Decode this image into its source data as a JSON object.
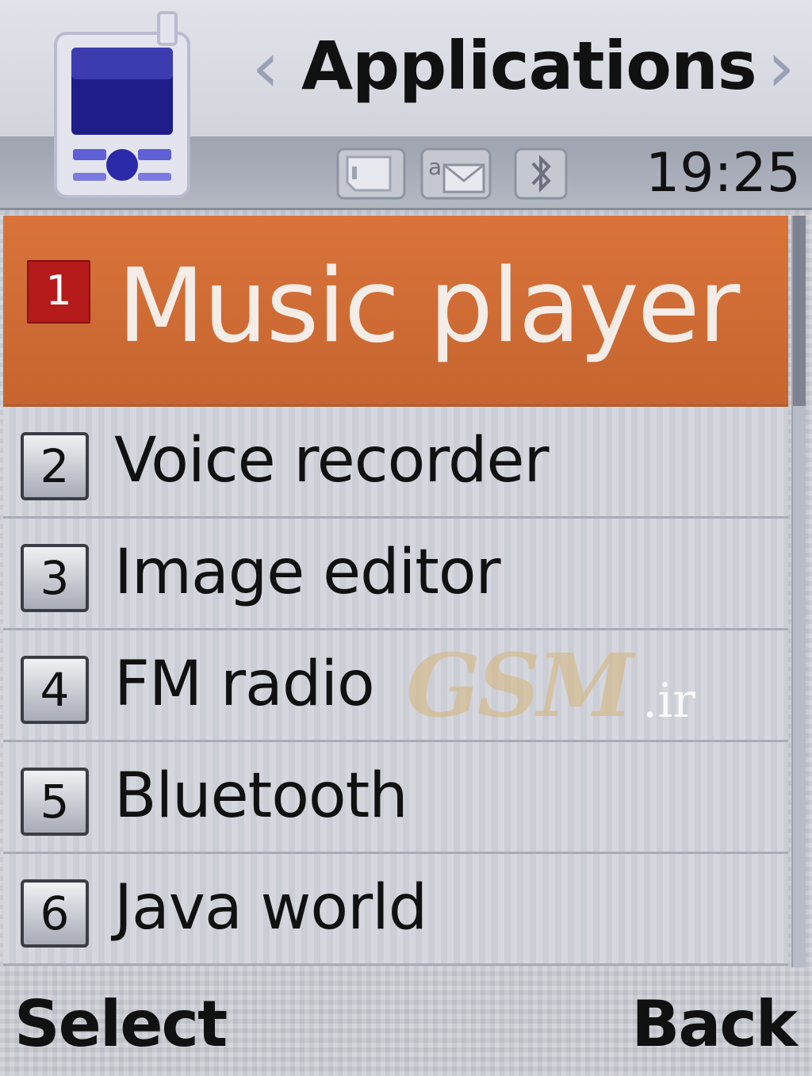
{
  "header": {
    "title": "Applications",
    "time": "19:25",
    "app_icon": "phone-device-icon",
    "status_icons": [
      "sim-card-icon",
      "message-icon",
      "bluetooth-icon"
    ]
  },
  "menu": {
    "items": [
      {
        "number": "1",
        "label": "Music player",
        "selected": true
      },
      {
        "number": "2",
        "label": "Voice recorder",
        "selected": false
      },
      {
        "number": "3",
        "label": "Image editor",
        "selected": false
      },
      {
        "number": "4",
        "label": "FM radio",
        "selected": false
      },
      {
        "number": "5",
        "label": "Bluetooth",
        "selected": false
      },
      {
        "number": "6",
        "label": "Java world",
        "selected": false
      }
    ]
  },
  "watermark": {
    "text": "GSM",
    "suffix": ".ir"
  },
  "softkeys": {
    "left": "Select",
    "right": "Back"
  },
  "colors": {
    "selected_row": "#c8672f",
    "selected_number_badge": "#b51b1b",
    "background": "#c9cbd3",
    "text": "#111111"
  }
}
